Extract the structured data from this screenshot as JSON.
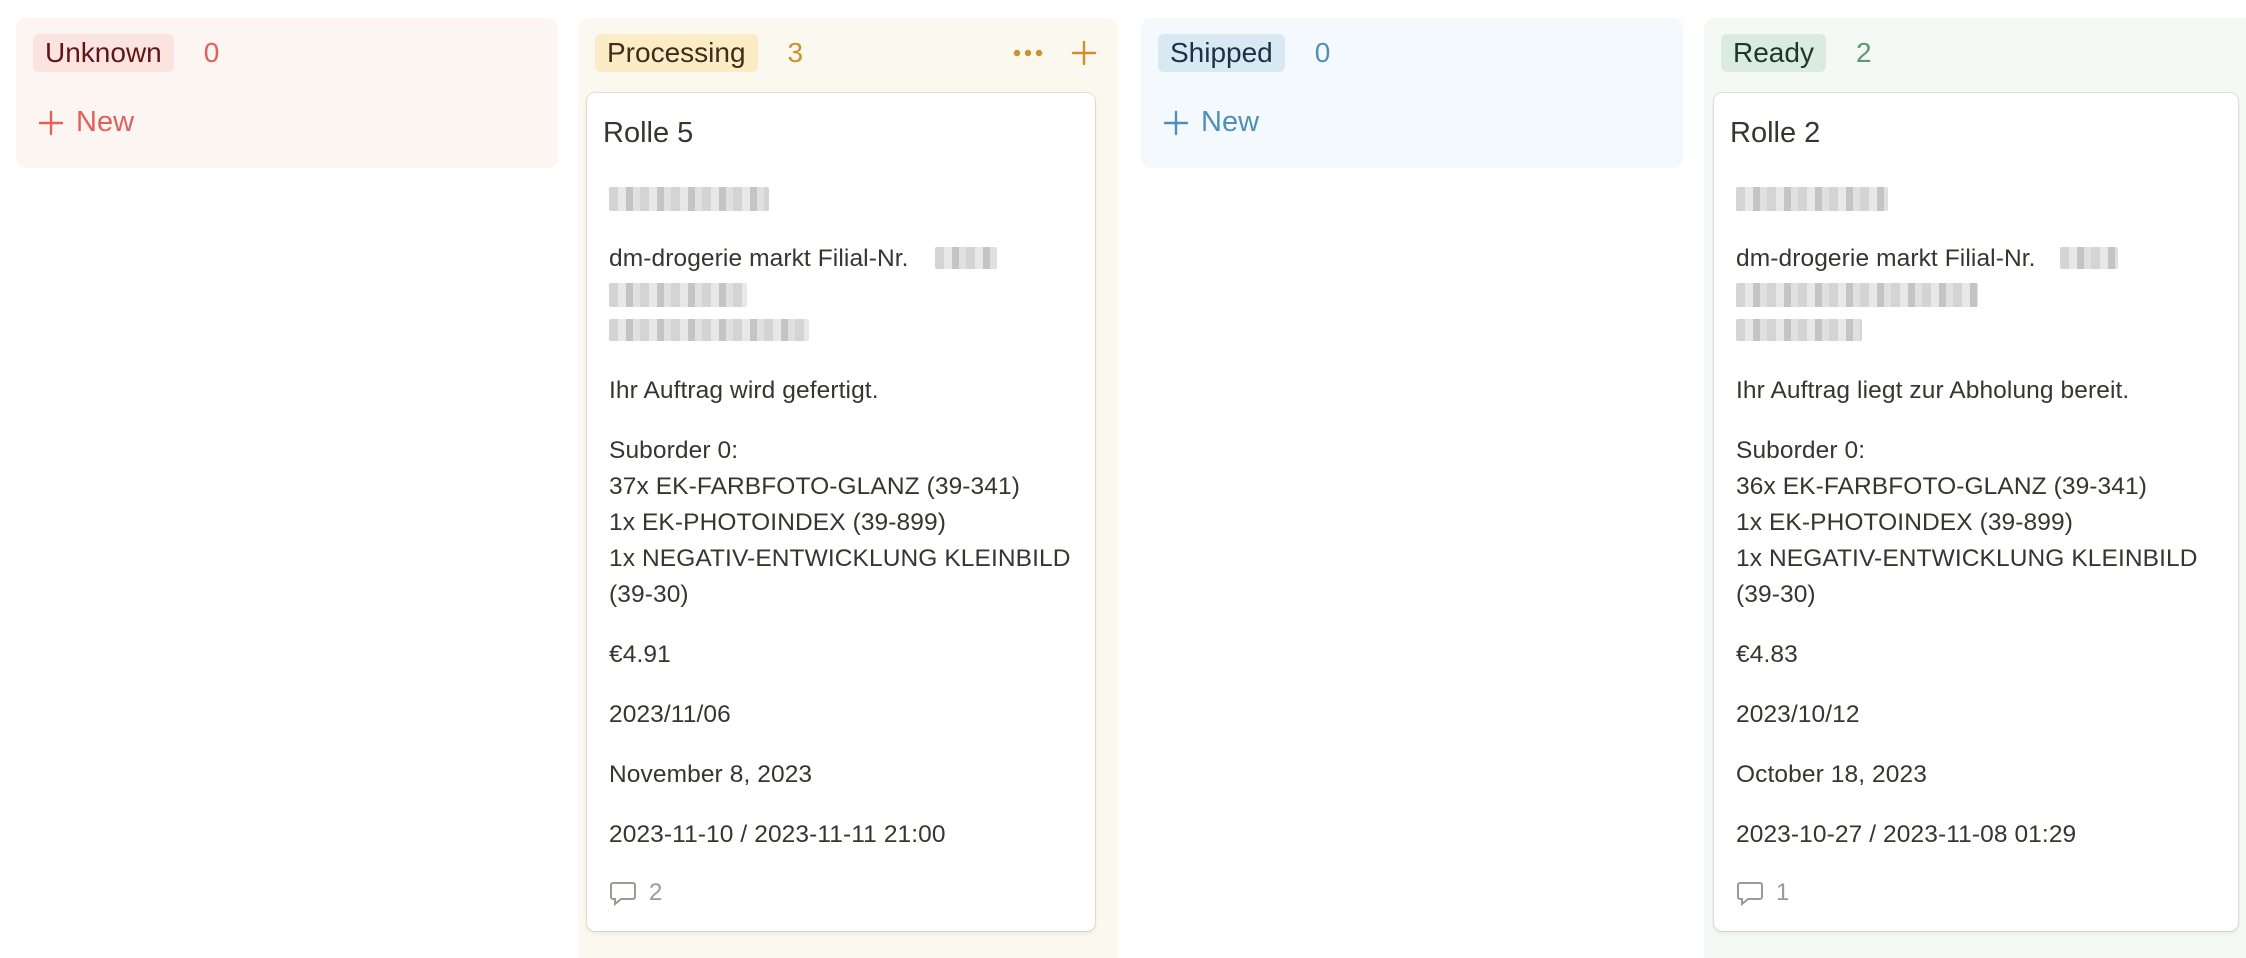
{
  "columns": {
    "unknown": {
      "label": "Unknown",
      "count": "0",
      "new_label": "New"
    },
    "processing": {
      "label": "Processing",
      "count": "3"
    },
    "shipped": {
      "label": "Shipped",
      "count": "0",
      "new_label": "New"
    },
    "ready": {
      "label": "Ready",
      "count": "2"
    }
  },
  "cards": [
    {
      "title": "Rolle 5",
      "store": "dm-drogerie markt Filial-Nr.",
      "status": "Ihr Auftrag wird gefertigt.",
      "suborder_label": "Suborder 0:",
      "items": [
        "37x EK-FARBFOTO-GLANZ (39-341)",
        "1x EK-PHOTOINDEX (39-899)",
        "1x NEGATIV-ENTWICKLUNG KLEINBILD",
        "(39-30)"
      ],
      "price": "€4.91",
      "order_date": "2023/11/06",
      "due_date": "November 8, 2023",
      "date_range": "2023-11-10 / 2023-11-11 21:00",
      "comment_count": "2"
    },
    {
      "title": "Rolle 2",
      "store": "dm-drogerie markt Filial-Nr.",
      "status": "Ihr Auftrag liegt zur Abholung bereit.",
      "suborder_label": "Suborder 0:",
      "items": [
        "36x EK-FARBFOTO-GLANZ (39-341)",
        "1x EK-PHOTOINDEX (39-899)",
        "1x NEGATIV-ENTWICKLUNG KLEINBILD",
        "(39-30)"
      ],
      "price": "€4.83",
      "order_date": "2023/10/12",
      "due_date": "October 18, 2023",
      "date_range": "2023-10-27 / 2023-11-08 01:29",
      "comment_count": "1"
    }
  ],
  "icons": {
    "new": "plus-icon",
    "more": "more-horizontal-icon",
    "add": "plus-icon",
    "comment": "comment-icon"
  },
  "colors": {
    "unknown_bg": "#fdf5f2",
    "unknown_pill": "#fbe3e0",
    "unknown_text": "#5d1715",
    "unknown_accent": "#e0605b",
    "processing_bg": "#fbf8ef",
    "processing_pill": "#fbecc5",
    "processing_text": "#402c1b",
    "processing_accent": "#cb912f",
    "shipped_bg": "#f3f9fc",
    "shipped_pill": "#d9e9f3",
    "shipped_text": "#183347",
    "shipped_accent": "#4f8fb8",
    "ready_bg": "#f5f9f5",
    "ready_pill": "#dcebe0",
    "ready_text": "#1c3829",
    "ready_accent": "#5c9a72"
  }
}
